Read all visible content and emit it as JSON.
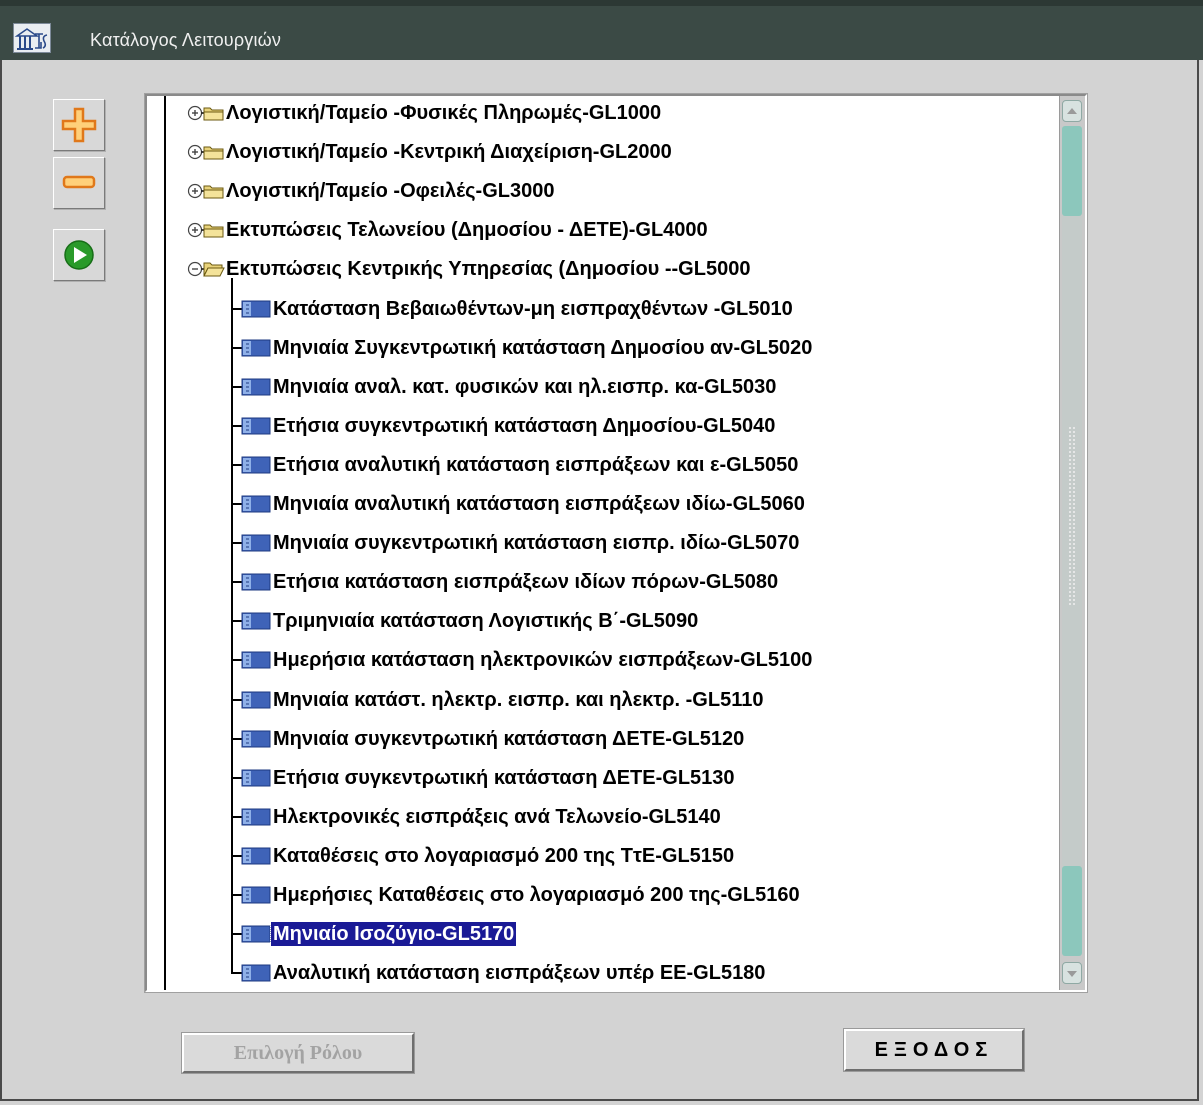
{
  "window": {
    "title": "Κατάλογος Λειτουργιών"
  },
  "toolbar": {
    "expand_icon": "plus-icon",
    "collapse_icon": "minus-icon",
    "run_icon": "play-icon",
    "colors": {
      "plus_minus": "#f0a020",
      "play": "#2a9a2a"
    }
  },
  "tree": {
    "nodes": [
      {
        "label": "Λογιστική/Ταμείο -Φυσικές Πληρωμές-GL1000",
        "type": "folder",
        "expanded": false
      },
      {
        "label": "Λογιστική/Ταμείο -Κεντρική Διαχείριση-GL2000",
        "type": "folder",
        "expanded": false
      },
      {
        "label": "Λογιστική/Ταμείο -Οφειλές-GL3000",
        "type": "folder",
        "expanded": false
      },
      {
        "label": "Εκτυπώσεις  Τελωνείου (Δημοσίου - ΔΕΤΕ)-GL4000",
        "type": "folder",
        "expanded": false
      },
      {
        "label": "Εκτυπώσεις  Κεντρικής Υπηρεσίας (Δημοσίου --GL5000",
        "type": "folder",
        "expanded": true,
        "children": [
          {
            "label": "Κατάσταση Βεβαιωθέντων-μη εισπραχθέντων -GL5010"
          },
          {
            "label": "Μηνιαία Συγκεντρωτική κατάσταση Δημοσίου αν-GL5020"
          },
          {
            "label": "Μηνιαία αναλ. κατ. φυσικών και ηλ.εισπρ. κα-GL5030"
          },
          {
            "label": "Ετήσια συγκεντρωτική κατάσταση Δημοσίου-GL5040"
          },
          {
            "label": "Ετήσια αναλυτική κατάσταση εισπράξεων και ε-GL5050"
          },
          {
            "label": "Μηνιαία αναλυτική κατάσταση εισπράξεων ιδίω-GL5060"
          },
          {
            "label": "Μηνιαία συγκεντρωτική κατάσταση εισπρ. ιδίω-GL5070"
          },
          {
            "label": "Ετήσια κατάσταση εισπράξεων ιδίων πόρων-GL5080"
          },
          {
            "label": "Τριμηνιαία κατάσταση Λογιστικής Β΄-GL5090"
          },
          {
            "label": "Ημερήσια κατάσταση ηλεκτρονικών εισπράξεων-GL5100"
          },
          {
            "label": "Μηνιαία κατάστ. ηλεκτρ. εισπρ. και ηλεκτρ. -GL5110"
          },
          {
            "label": "Μηνιαία συγκεντρωτική κατάσταση ΔΕΤΕ-GL5120"
          },
          {
            "label": "Ετήσια συγκεντρωτική κατάσταση ΔΕΤΕ-GL5130"
          },
          {
            "label": "Ηλεκτρονικές εισπράξεις ανά Τελωνείο-GL5140"
          },
          {
            "label": "Καταθέσεις στο λογαριασμό 200 της ΤτΕ-GL5150"
          },
          {
            "label": "Ημερήσιες Καταθέσεις στο λογαριασμό 200 της-GL5160"
          },
          {
            "label": "Μηνιαίο Ισοζύγιο-GL5170",
            "selected": true
          },
          {
            "label": "Αναλυτική κατάσταση εισπράξεων υπέρ ΕΕ-GL5180"
          }
        ]
      }
    ],
    "colors": {
      "selection": "#1a1a96",
      "folder": "#e8d27a",
      "doc": "#3f63b8"
    }
  },
  "buttons": {
    "role_label": "Επιλογή Ρόλου",
    "role_enabled": false,
    "exit_label": "ΕΞΟΔΟΣ"
  }
}
